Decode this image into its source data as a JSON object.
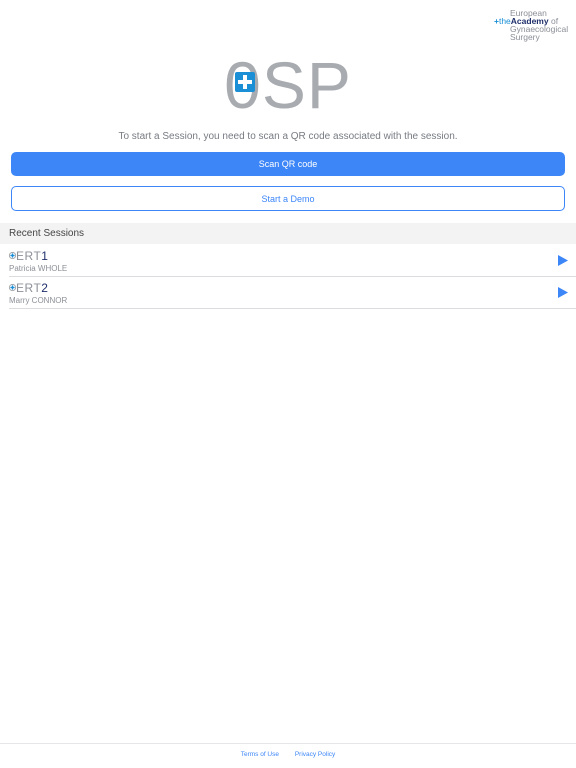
{
  "academy_logo": {
    "line1": "European",
    "plus": "+",
    "the": "the",
    "academy": "Academy",
    "of": "of",
    "line3": "Gynaecological",
    "line4": "Surgery"
  },
  "app_logo": {
    "rest": "SP"
  },
  "instruction": "To start a Session, you need to scan a QR code associated with the session.",
  "buttons": {
    "scan_label": "Scan QR code",
    "demo_label": "Start a Demo"
  },
  "recent": {
    "header": "Recent Sessions",
    "sessions": [
      {
        "prefix": "ERT",
        "number": "1",
        "name": "Patricia WHOLE"
      },
      {
        "prefix": "ERT",
        "number": "2",
        "name": "Marry CONNOR"
      }
    ]
  },
  "footer": {
    "terms": "Terms of Use",
    "privacy": "Privacy Policy"
  },
  "colors": {
    "accent": "#3d86f7",
    "logo_blue": "#1a8fd6",
    "navy": "#1f2f6b",
    "logo_gray": "#a8abb0"
  }
}
